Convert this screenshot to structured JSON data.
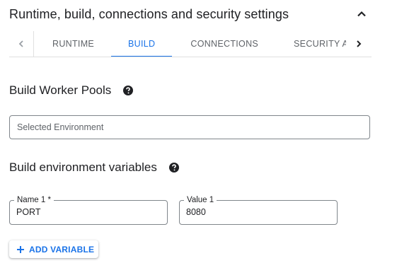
{
  "section": {
    "title": "Runtime, build, connections and security settings"
  },
  "tabs": [
    {
      "label": "RUNTIME",
      "active": false
    },
    {
      "label": "BUILD",
      "active": true
    },
    {
      "label": "CONNECTIONS",
      "active": false
    },
    {
      "label": "SECURITY AND",
      "active": false
    }
  ],
  "worker_pools": {
    "title": "Build Worker Pools",
    "select_placeholder": "Selected Environment"
  },
  "env_vars": {
    "title": "Build environment variables",
    "name_label": "Name 1 *",
    "name_value": "PORT",
    "value_label": "Value 1",
    "value_value": "8080",
    "add_button_label": "ADD VARIABLE"
  },
  "colors": {
    "accent": "#1a73e8",
    "text": "#202124",
    "secondary_text": "#5f6368",
    "border": "#80868b"
  }
}
